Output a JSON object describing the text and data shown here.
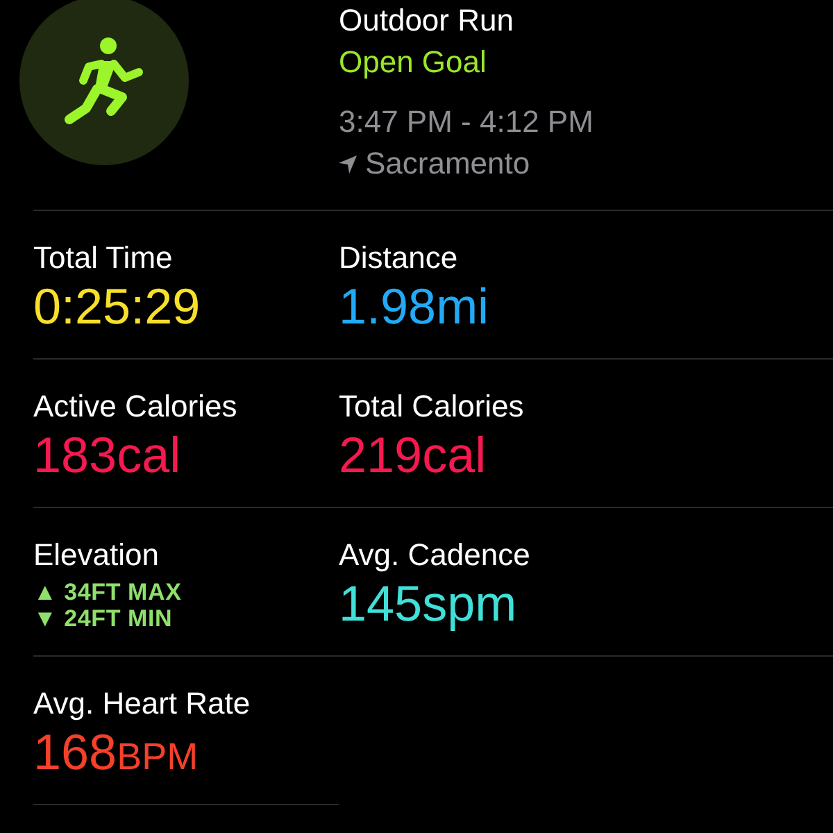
{
  "workout": {
    "title": "Outdoor Run",
    "goal": "Open Goal",
    "time": "3:47 PM - 4:12 PM",
    "location": "Sacramento"
  },
  "metrics": [
    {
      "kind": "value",
      "label": "Total Time",
      "value": "0:25:29",
      "color": "#f8e02a"
    },
    {
      "kind": "value",
      "label": "Distance",
      "value": "1.98mi",
      "color": "#22aaf6"
    },
    {
      "kind": "value",
      "label": "Active Calories",
      "value": "183cal",
      "color": "#f6194f"
    },
    {
      "kind": "value",
      "label": "Total Calories",
      "value": "219cal",
      "color": "#f6194f"
    },
    {
      "kind": "elevation",
      "label": "Elevation",
      "lines": [
        "▲ 34FT MAX",
        "▼ 24FT MIN"
      ],
      "color": "#8ee06a"
    },
    {
      "kind": "value",
      "label": "Avg. Cadence",
      "value": "145spm",
      "color": "#40e0d8"
    },
    {
      "kind": "value",
      "label": "Avg. Heart Rate",
      "value": "168",
      "unit": "BPM",
      "color": "#f5402a"
    }
  ]
}
